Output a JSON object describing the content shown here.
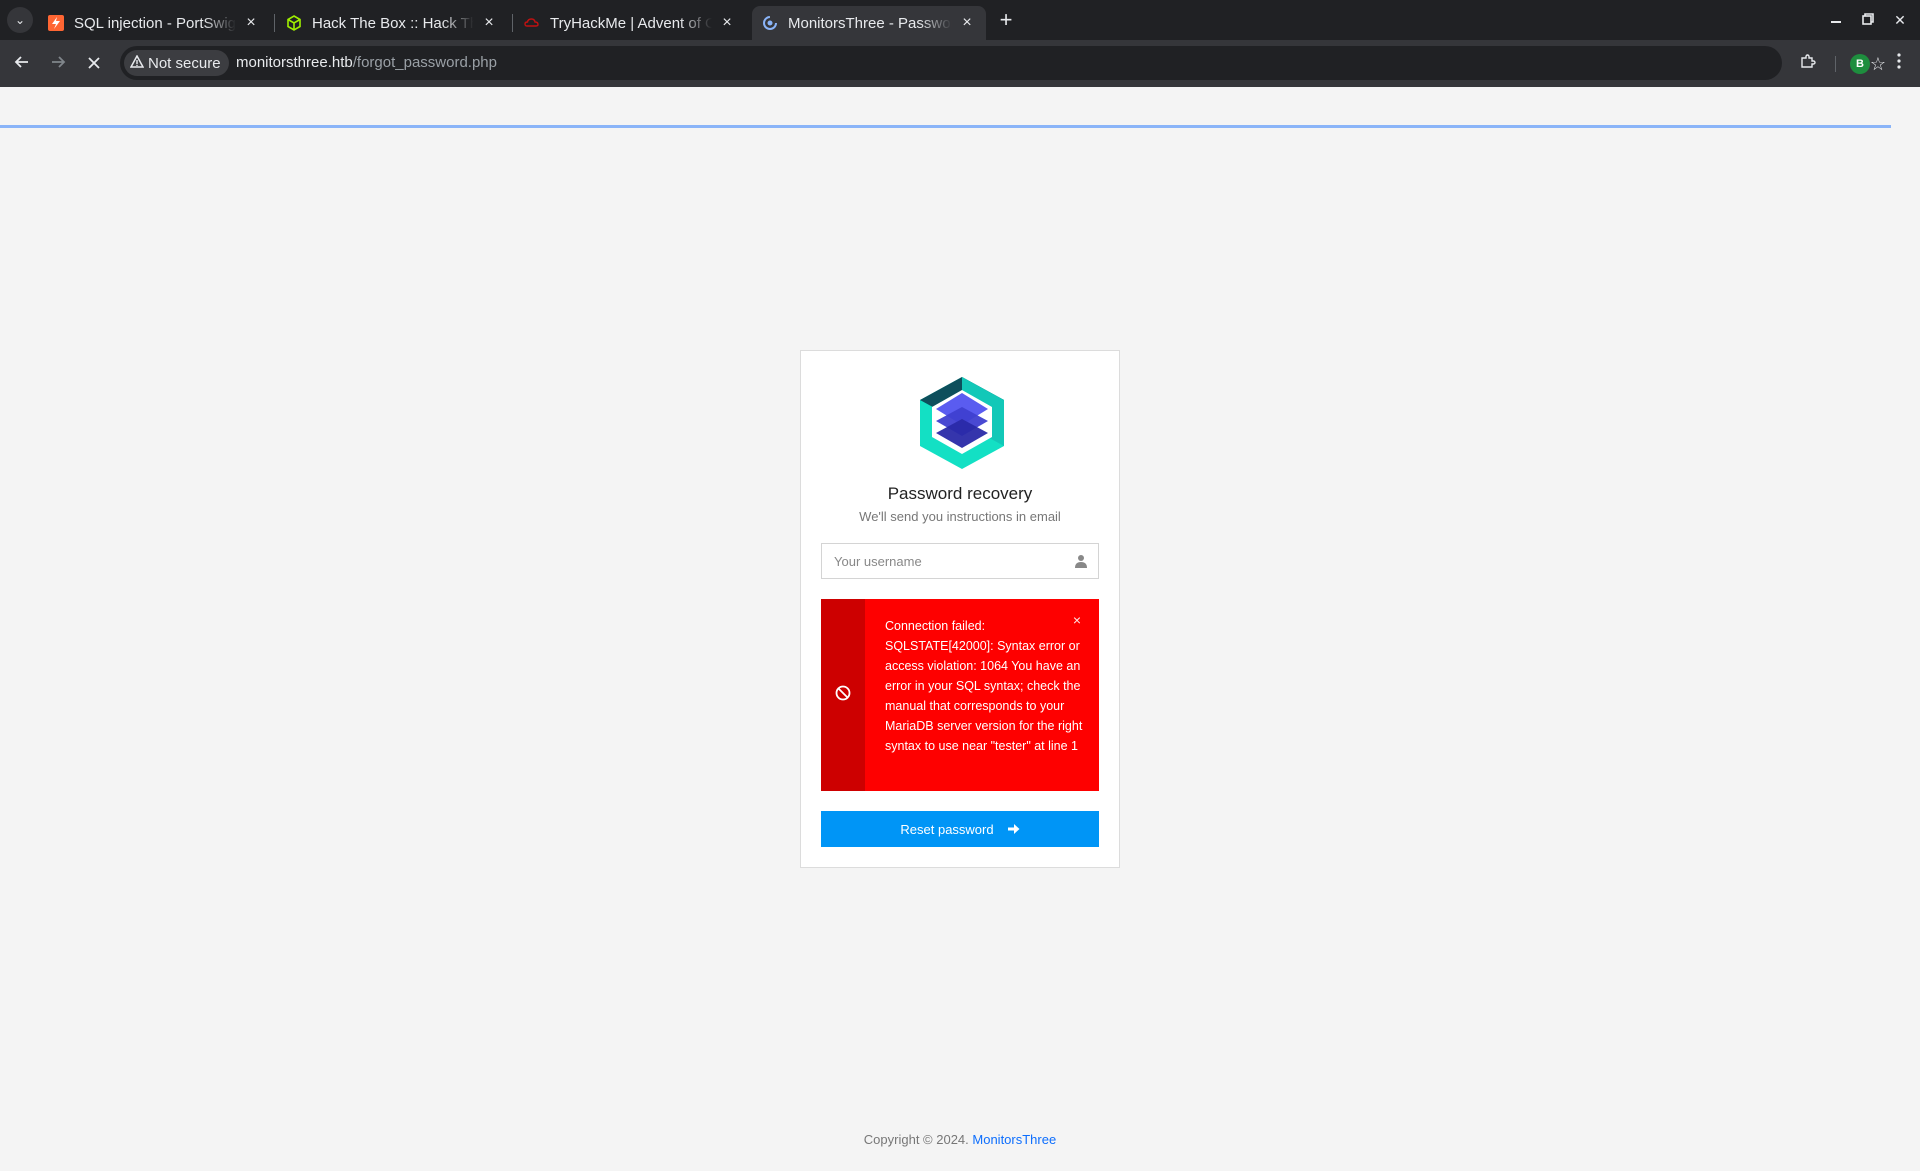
{
  "browser": {
    "tabs": [
      {
        "title": "SQL injection - PortSwigger",
        "favicon": "portswigger-icon",
        "active": false
      },
      {
        "title": "Hack The Box :: Hack The Box",
        "favicon": "hackthebox-icon",
        "active": false
      },
      {
        "title": "TryHackMe | Advent of Cyber",
        "favicon": "tryhackme-icon",
        "active": false
      },
      {
        "title": "MonitorsThree - Password recovery",
        "favicon": "loading-icon",
        "active": true
      }
    ],
    "security_label": "Not secure",
    "url_host": "monitorsthree.htb",
    "url_path": "/forgot_password.php",
    "profile_initial": "B",
    "load_progress": 0.985
  },
  "page": {
    "title": "Password recovery",
    "subtitle": "We'll send you instructions in email",
    "username_placeholder": "Your username",
    "alert_message": "Connection failed: SQLSTATE[42000]: Syntax error or access violation: 1064 You have an error in your SQL syntax; check the manual that corresponds to your MariaDB server version for the right syntax to use near \"tester\" at line 1",
    "alert_close": "×",
    "reset_label": "Reset password",
    "footer_text": "Copyright © 2024. ",
    "footer_link": "MonitorsThree"
  },
  "colors": {
    "alert_bg": "#fe0000",
    "alert_side": "#cd0000",
    "button": "#0095f6",
    "link": "#0d6efd"
  }
}
